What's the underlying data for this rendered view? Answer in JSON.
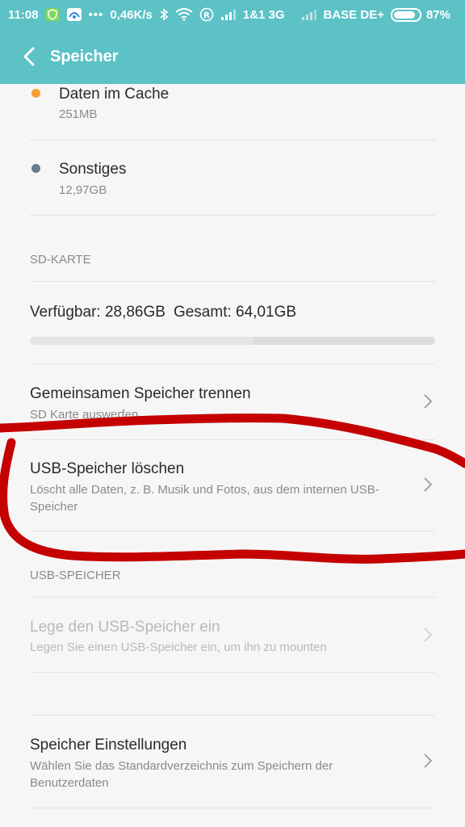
{
  "statusbar": {
    "time": "11:08",
    "dots": "•••",
    "speed": "0,46K/s",
    "carrier1": "1&1 3G",
    "carrier2": "BASE DE+",
    "battery_label": "87%",
    "battery_level": 0.87
  },
  "appbar": {
    "title": "Speicher"
  },
  "legend": [
    {
      "title": "Daten im Cache",
      "size": "251MB",
      "color": "#f5a030"
    },
    {
      "title": "Sonstiges",
      "size": "12,97GB",
      "color": "#6b7b8c"
    }
  ],
  "sdcard": {
    "header": "SD-KARTE",
    "available": "Verfügbar: 28,86GB",
    "total": "Gesamt: 64,01GB",
    "used_fraction": 0.45
  },
  "settings": [
    {
      "title": "Gemeinsamen Speicher trennen",
      "subtitle": "SD Karte auswerfen"
    },
    {
      "title": "USB-Speicher löschen",
      "subtitle": "Löscht alle Daten, z. B. Musik und Fotos, aus dem internen USB-Speicher"
    }
  ],
  "usb": {
    "header": "USB-SPEICHER",
    "title": "Lege den USB-Speicher ein",
    "subtitle": "Legen Sie einen USB-Speicher ein, um ihn zu mounten"
  },
  "storage_settings": {
    "title": "Speicher Einstellungen",
    "subtitle": "Wählen Sie das Standardverzeichnis zum Speichern der Benutzerdaten"
  },
  "colors": {
    "accent": "#5cc2c6",
    "annotation": "#c40000"
  }
}
